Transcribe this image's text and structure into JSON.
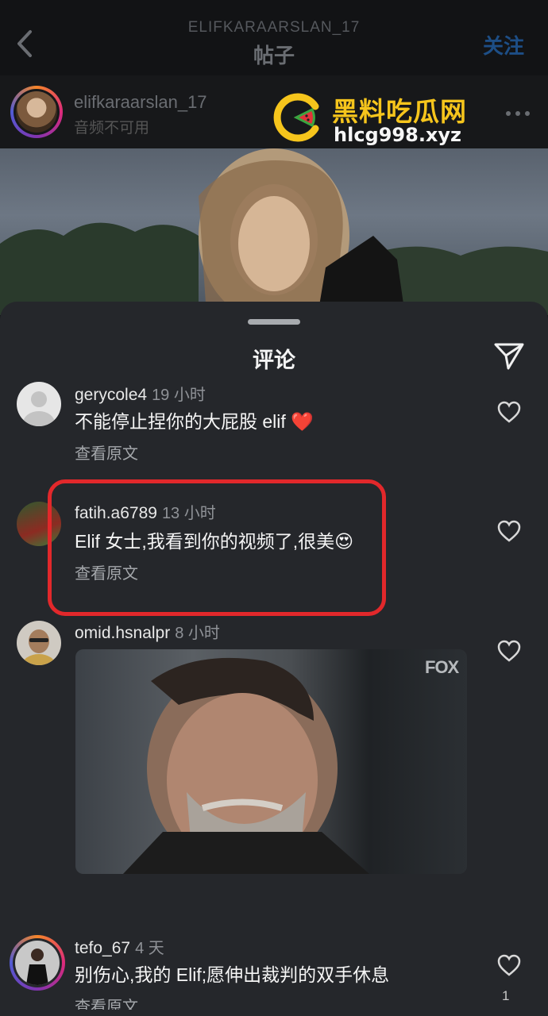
{
  "nav": {
    "subtitle": "ELIFKARAARSLAN_17",
    "title": "帖子",
    "follow_label": "关注"
  },
  "post": {
    "username": "elifkaraarslan_17",
    "subtitle": "音频不可用"
  },
  "watermark": {
    "name": "黑料吃瓜网",
    "url": "hlcg998.xyz"
  },
  "sheet": {
    "title": "评论"
  },
  "comments": [
    {
      "username": "gerycole4",
      "time": "19 小时",
      "text": "不能停止捏你的大屁股 elif ❤️",
      "translate": "查看原文"
    },
    {
      "username": "fatih.a6789",
      "time": "13 小时",
      "text": "Elif 女士,我看到你的视频了,很美😍",
      "translate": "查看原文"
    },
    {
      "username": "omid.hsnalpr",
      "time": "8 小时",
      "media_label": "FOX"
    },
    {
      "username": "tefo_67",
      "time": "4 天",
      "text": "别伤心,我的 Elif;愿伸出裁判的双手休息",
      "translate": "查看原文",
      "likes": "1"
    }
  ],
  "colors": {
    "highlight": "#e2282b",
    "follow": "#1d4e86",
    "watermark": "#f6c51c"
  }
}
